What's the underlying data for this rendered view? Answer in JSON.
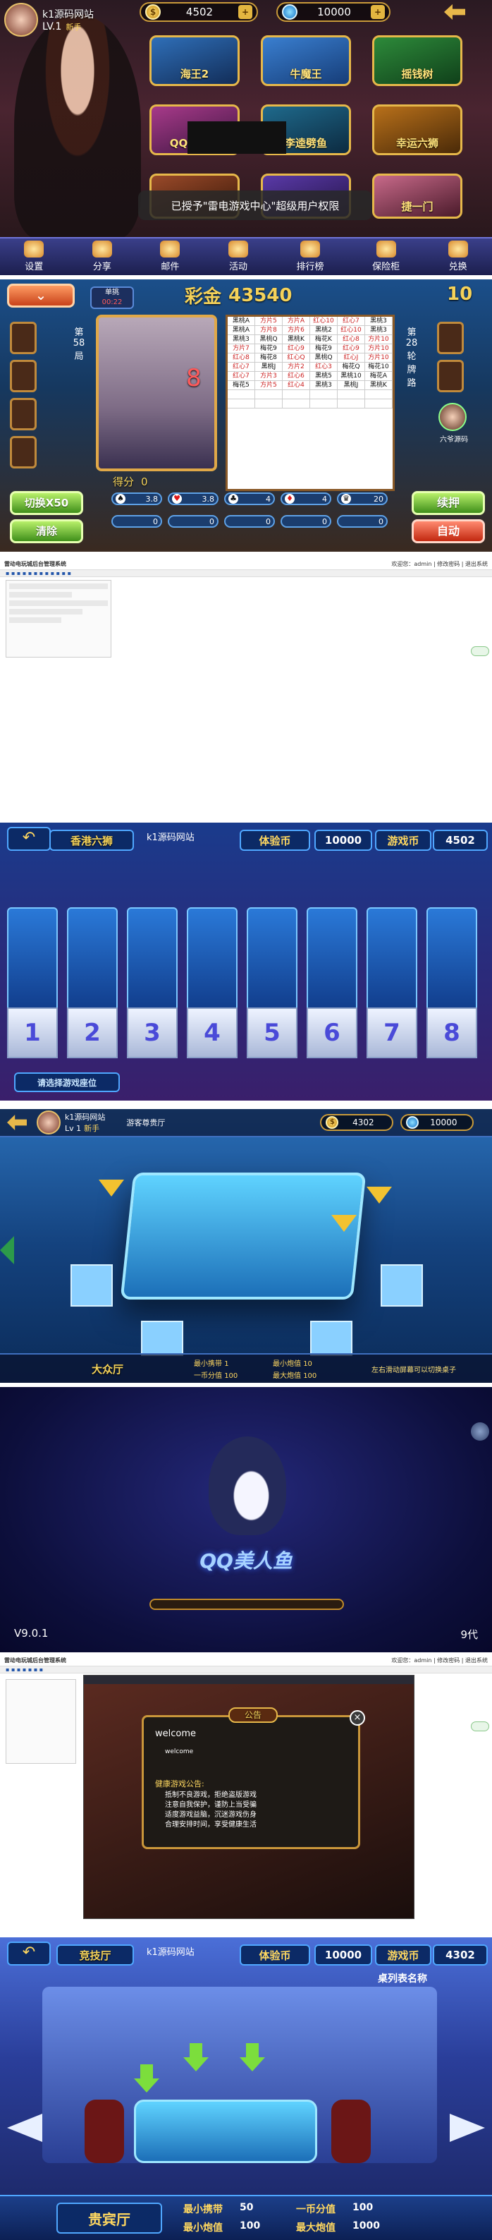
{
  "lobby": {
    "site_name": "k1源码网站",
    "level": "LV.1",
    "rank": "新手",
    "gold": "4502",
    "diamonds": "10000",
    "games": [
      "海王2",
      "牛魔王",
      "摇钱树",
      "QQ美人鱼",
      "李逵劈鱼",
      "幸运六狮",
      "",
      "",
      "捷一门"
    ],
    "toast": "已授予\"雷电游戏中心\"超级用户权限",
    "bottom_nav": [
      "设置",
      "分享",
      "邮件",
      "活动",
      "排行榜",
      "保险柜",
      "兑换"
    ]
  },
  "slot": {
    "title_prefix": "彩金",
    "jackpot": "43540",
    "small_label": "单挑",
    "timer": "00:22",
    "right_count": "10",
    "left_vertical": [
      "第",
      "58",
      "局"
    ],
    "right_vertical": [
      "第",
      "28",
      "轮",
      "牌",
      "路"
    ],
    "score_label": "得分",
    "score_value": "0",
    "player_name": "六爷源码",
    "switch_button": "切换X50",
    "clear_button": "清除",
    "continue_button": "续押",
    "auto_button": "自动",
    "suits": [
      {
        "name": "spade",
        "glyph": "♠",
        "odds": "3.8",
        "bet": "0",
        "color": "#111111"
      },
      {
        "name": "heart",
        "glyph": "♥",
        "odds": "3.8",
        "bet": "0",
        "color": "#e01818"
      },
      {
        "name": "club",
        "glyph": "♣",
        "odds": "4",
        "bet": "0",
        "color": "#111111"
      },
      {
        "name": "diamond",
        "glyph": "♦",
        "odds": "4",
        "bet": "0",
        "color": "#e01818"
      },
      {
        "name": "king",
        "glyph": "♛",
        "odds": "20",
        "bet": "0",
        "color": "#111111"
      }
    ],
    "table_rows": [
      [
        "黑桃A",
        "方片5",
        "方片A",
        "红心10",
        "红心7",
        "黑桃3"
      ],
      [
        "黑桃A",
        "方片8",
        "方片6",
        "黑桃2",
        "红心10",
        "黑桃3"
      ],
      [
        "黑桃3",
        "黑桃Q",
        "黑桃K",
        "梅花K",
        "红心8",
        "方片10"
      ],
      [
        "方片7",
        "梅花9",
        "红心9",
        "梅花9",
        "红心9",
        "方片10"
      ],
      [
        "红心8",
        "梅花8",
        "红心Q",
        "黑桃Q",
        "红心J",
        "方片10"
      ],
      [
        "红心7",
        "黑桃J",
        "方片2",
        "红心3",
        "梅花Q",
        "梅花10"
      ],
      [
        "红心7",
        "方片3",
        "红心6",
        "黑桃5",
        "黑桃10",
        "梅花A"
      ],
      [
        "梅花5",
        "方片5",
        "红心4",
        "黑桃3",
        "黑桃J",
        "黑桃K"
      ],
      [
        "",
        "",
        "",
        "",
        "",
        ""
      ],
      [
        "",
        "",
        "",
        "",
        "",
        ""
      ]
    ]
  },
  "admin1": {
    "title": "雷动电玩城后台管理系统",
    "right_links": "欢迎您：admin | 修改密码 | 退出系统"
  },
  "lion": {
    "title": "香港六狮",
    "site": "k1源码网站",
    "label1": "体验币",
    "value1": "10000",
    "label2": "游戏币",
    "value2": "4502",
    "machines": [
      "1",
      "2",
      "3",
      "4",
      "5",
      "6",
      "7",
      "8"
    ],
    "hint": "请选择游戏座位"
  },
  "fish_lobby": {
    "site": "k1源码网站",
    "level": "Lv 1",
    "rank": "新手",
    "subtitle": "游客尊贵厅",
    "gold": "4302",
    "diamonds": "10000",
    "hall_name": "大众厅",
    "stats": [
      "最小携带 1",
      "最小炮值 10",
      "一币分值 100",
      "最大炮值 100"
    ],
    "scroll_hint": "左右滑动屏幕可以切换桌子"
  },
  "loading": {
    "logo": "QQ美人鱼",
    "version": "V9.0.1",
    "generation": "9代"
  },
  "admin2": {
    "title": "雷动电玩城后台管理系统",
    "right_links": "欢迎您：admin | 修改密码 | 退出系统",
    "notice_title": "公告",
    "welcome": "welcome",
    "welcome2": "welcome",
    "health_title": "健康游戏公告:",
    "health_lines": [
      "抵制不良游戏，拒绝盗版游戏",
      "注意自我保护，谨防上当受骗",
      "适度游戏益脑，沉迷游戏伤身",
      "合理安排时间，享受健康生活"
    ]
  },
  "arena": {
    "title": "竞技厅",
    "site": "k1源码网站",
    "label1": "体验币",
    "value1": "10000",
    "label2": "游戏币",
    "value2": "4302",
    "table_list": "桌列表名称",
    "hall": "贵宾厅",
    "stats": [
      {
        "label": "最小携带",
        "value": "50"
      },
      {
        "label": "一币分值",
        "value": "100"
      },
      {
        "label": "最小炮值",
        "value": "100"
      },
      {
        "label": "最大炮值",
        "value": "1000"
      }
    ]
  }
}
